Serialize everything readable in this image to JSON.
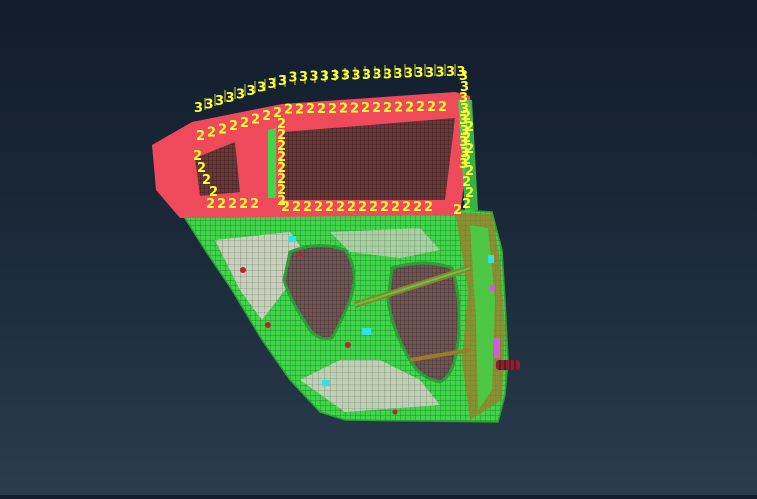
{
  "viewport": {
    "model": "door-panel-fe-mesh",
    "colors": {
      "background_top": "#111d2c",
      "background_bottom": "#2a3c4e",
      "door_inner_panel": "#3fd64a",
      "window_frame": "#ee4a5c",
      "glass_mesh": "#6a3838",
      "cavity_mesh": "#6e5454",
      "reinforcement": "#a07a2a",
      "label": "#ffff33",
      "connector_cyan": "#33e0e8",
      "connector_magenta": "#d05cd8"
    },
    "labels": {
      "outer_marker": "3",
      "inner_marker": "2"
    }
  }
}
